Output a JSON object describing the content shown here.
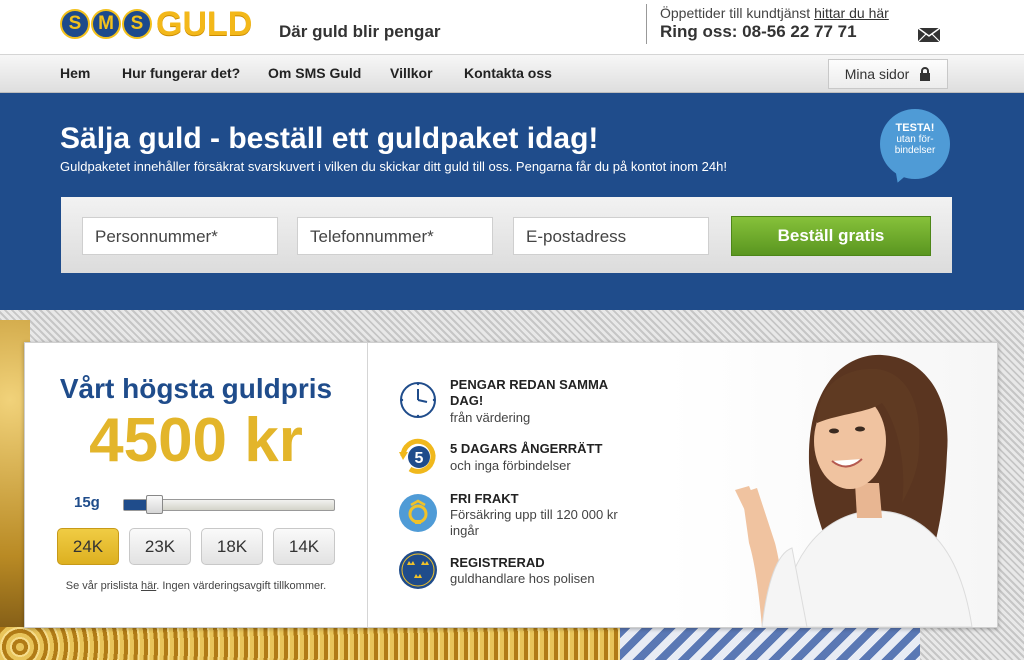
{
  "header": {
    "logo": {
      "coins": [
        "S",
        "M",
        "S"
      ],
      "word": "GULD"
    },
    "tagline": "Där guld blir pengar",
    "hours_prefix": "Öppettider till kundtjänst",
    "hours_link": "hittar du här",
    "phone": "Ring oss: 08-56 22 77 71",
    "mail_icon": "envelope-icon"
  },
  "nav": {
    "items": [
      "Hem",
      "Hur fungerar det?",
      "Om SMS Guld",
      "Villkor",
      "Kontakta oss"
    ],
    "mina_sidor": "Mina sidor",
    "lock_icon": "lock-icon"
  },
  "hero": {
    "title": "Sälja guld - beställ ett guldpaket idag!",
    "subtitle": "Guldpaketet innehåller försäkrat svarskuvert i vilken du skickar ditt guld till oss. Pengarna får du på kontot inom 24h!",
    "testa_badge": [
      "TESTA!",
      "utan för-",
      "bindelser"
    ],
    "form": {
      "personnummer_placeholder": "Personnummer*",
      "telefon_placeholder": "Telefonnummer*",
      "email_placeholder": "E-postadress",
      "submit_label": "Beställ gratis"
    }
  },
  "price_panel": {
    "heading": "Vårt högsta guldpris",
    "price": "4500 kr",
    "weight": "15g",
    "slider_fraction": 0.12,
    "karats": [
      {
        "label": "24K",
        "active": true
      },
      {
        "label": "23K",
        "active": false
      },
      {
        "label": "18K",
        "active": false
      },
      {
        "label": "14K",
        "active": false
      }
    ],
    "pricelist_prefix": "Se vår prislista",
    "pricelist_link": "här",
    "pricelist_suffix": ". Ingen värderingsavgift tillkommer."
  },
  "features": [
    {
      "icon": "clock-icon",
      "title": "PENGAR REDAN SAMMA DAG!",
      "sub": "från värdering"
    },
    {
      "icon": "return-5-icon",
      "title": "5 DAGARS ÅNGERRÄTT",
      "sub": "och inga förbindelser",
      "icon_text": "5"
    },
    {
      "icon": "post-horn-icon",
      "title": "FRI FRAKT",
      "sub": "Försäkring upp till 120 000 kr ingår"
    },
    {
      "icon": "three-crowns-icon",
      "title": "REGISTRERAD",
      "sub": "guldhandlare hos polisen"
    }
  ],
  "colors": {
    "brand_blue": "#1f4c8b",
    "gold": "#e3b52a",
    "green_button": "#6aa82a",
    "badge_blue": "#4f9bd6"
  }
}
